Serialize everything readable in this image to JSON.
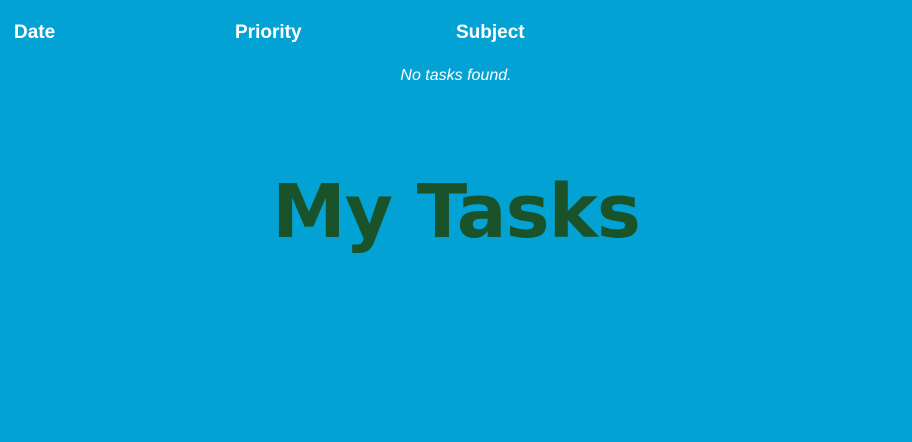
{
  "table": {
    "columns": [
      "Date",
      "Priority",
      "Subject"
    ],
    "empty_message": "No tasks found."
  },
  "page": {
    "title": "My Tasks"
  },
  "colors": {
    "background": "#02a3d4",
    "header_text": "#ffffff",
    "title_text": "#1a5229"
  }
}
